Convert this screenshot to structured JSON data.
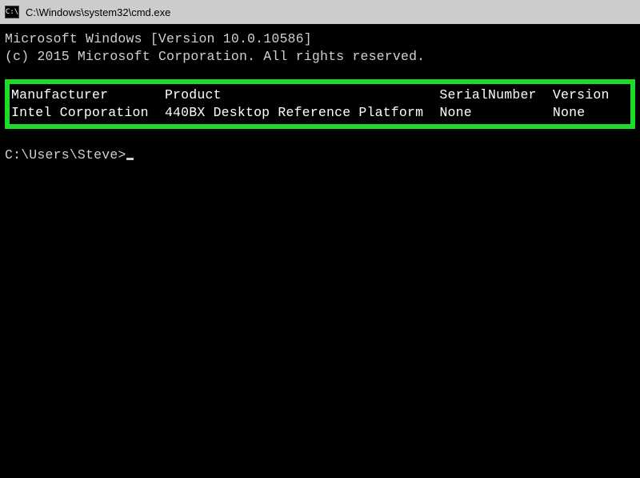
{
  "titlebar": {
    "icon_text": "C:\\",
    "title": "C:\\Windows\\system32\\cmd.exe"
  },
  "banner": {
    "line1": "Microsoft Windows [Version 10.0.10586]",
    "line2": "(c) 2015 Microsoft Corporation. All rights reserved."
  },
  "baseboard": {
    "headers": {
      "manufacturer": "Manufacturer",
      "product": "Product",
      "serialnumber": "SerialNumber",
      "version": "Version"
    },
    "row": {
      "manufacturer": "Intel Corporation",
      "product": "440BX Desktop Reference Platform",
      "serialnumber": "None",
      "version": "None"
    }
  },
  "prompt": "C:\\Users\\Steve>"
}
